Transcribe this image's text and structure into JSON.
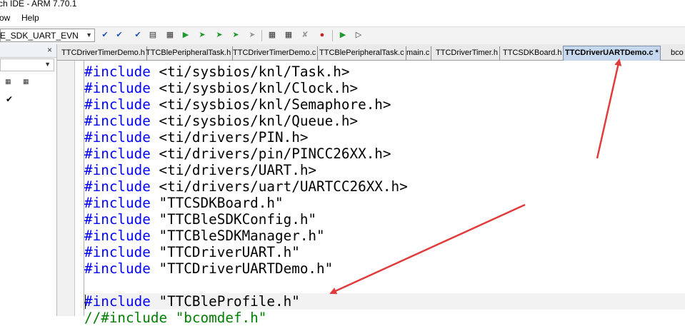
{
  "window": {
    "title": "ch IDE - ARM 7.70.1"
  },
  "menu": {
    "items": [
      {
        "label": "ow"
      },
      {
        "label": "Help"
      }
    ]
  },
  "toolbar": {
    "target_value": "E_SDK_UART_EVN"
  },
  "tabs": [
    {
      "label": "TTCDriverTimerDemo.h",
      "active": false
    },
    {
      "label": "TTCBlePeripheralTask.h",
      "active": false
    },
    {
      "label": "TTCDriverTimerDemo.c",
      "active": false
    },
    {
      "label": "TTCBlePeripheralTask.c",
      "active": false
    },
    {
      "label": "main.c",
      "active": false
    },
    {
      "label": "TTCDriverTimer.h",
      "active": false
    },
    {
      "label": "TTCSDKBoard.h",
      "active": false
    },
    {
      "label": "TTCDriverUARTDemo.c *",
      "active": true
    },
    {
      "label": "bco",
      "active": false
    }
  ],
  "editor": {
    "lines": [
      {
        "keyword": "#include",
        "rest": " <ti/sysbios/knl/Task.h>"
      },
      {
        "keyword": "#include",
        "rest": " <ti/sysbios/knl/Clock.h>"
      },
      {
        "keyword": "#include",
        "rest": " <ti/sysbios/knl/Semaphore.h>"
      },
      {
        "keyword": "#include",
        "rest": " <ti/sysbios/knl/Queue.h>"
      },
      {
        "keyword": "#include",
        "rest": " <ti/drivers/PIN.h>"
      },
      {
        "keyword": "#include",
        "rest": " <ti/drivers/pin/PINCC26XX.h>"
      },
      {
        "keyword": "#include",
        "rest": " <ti/drivers/UART.h>"
      },
      {
        "keyword": "#include",
        "rest": " <ti/drivers/uart/UARTCC26XX.h>"
      },
      {
        "keyword": "#include",
        "rest": " \"TTCSDKBoard.h\""
      },
      {
        "keyword": "#include",
        "rest": " \"TTCBleSDKConfig.h\""
      },
      {
        "keyword": "#include",
        "rest": " \"TTCBleSDKManager.h\""
      },
      {
        "keyword": "#include",
        "rest": " \"TTCDriverUART.h\""
      },
      {
        "keyword": "#include",
        "rest": " \"TTCDriverUARTDemo.h\""
      },
      {
        "keyword": "",
        "rest": ""
      },
      {
        "keyword": "#include",
        "rest": " \"TTCBleProfile.h\"",
        "current": true
      },
      {
        "keyword": "",
        "rest": "//#include \"bcomdef.h\"",
        "comment": true
      }
    ]
  },
  "annotation_color": "#e03c3c",
  "keyword_color": "#0000ff"
}
